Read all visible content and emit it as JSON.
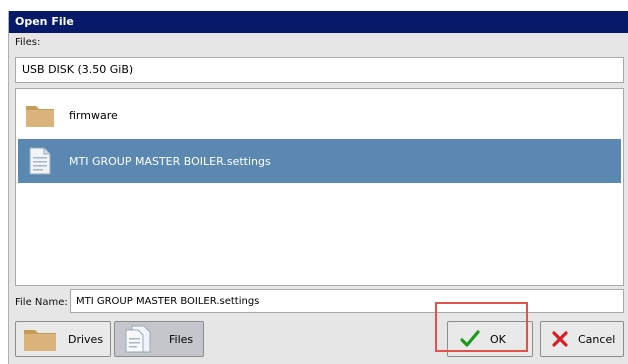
{
  "dialog": {
    "title": "Open File"
  },
  "files_label": "Files:",
  "drive": {
    "value": "USB DISK (3.50 GiB)"
  },
  "list": {
    "items": [
      {
        "label": "firmware",
        "icon": "folder-icon",
        "selected": false
      },
      {
        "label": "MTI GROUP MASTER BOILER.settings",
        "icon": "file-icon",
        "selected": true
      }
    ]
  },
  "filename": {
    "label": "File Name:",
    "value": "MTI GROUP MASTER BOILER.settings"
  },
  "buttons": {
    "drives": "Drives",
    "files": "Files",
    "ok": "OK",
    "cancel": "Cancel"
  },
  "colors": {
    "titlebar": "#071a6a",
    "selection": "#5b88b0",
    "ok_check": "#1a9a1a",
    "cancel_x": "#d42020",
    "highlight": "#e0524b",
    "folder": "#d7b27a"
  }
}
